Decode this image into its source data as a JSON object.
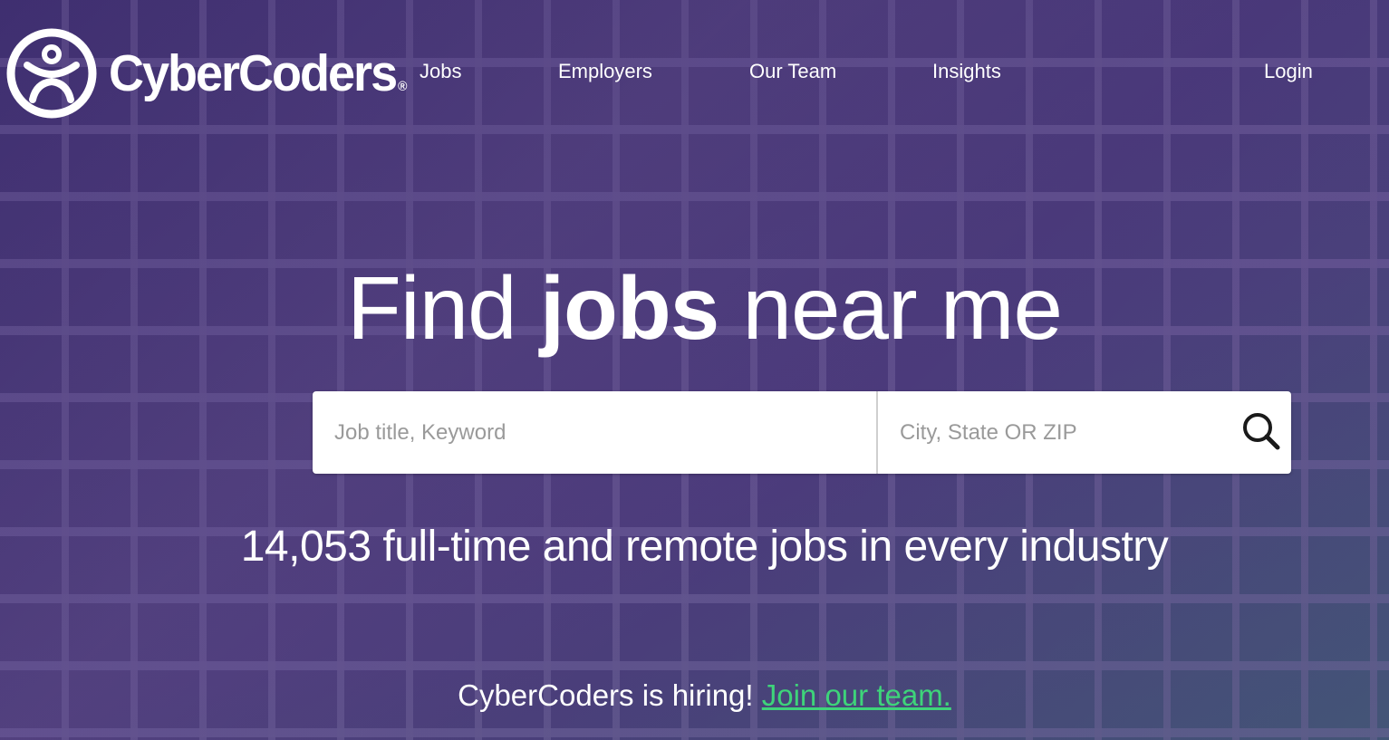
{
  "brand": {
    "name": "CyberCoders",
    "registered_mark": "®",
    "logo_icon": "person-circle-icon"
  },
  "nav": {
    "jobs": "Jobs",
    "employers": "Employers",
    "our_team": "Our Team",
    "insights": "Insights",
    "login": "Login"
  },
  "hero": {
    "headline_prefix": "Find ",
    "headline_bold": "jobs",
    "headline_suffix": " near me",
    "subheadline": "14,053 full-time and remote jobs in every industry",
    "hiring_text": "CyberCoders is hiring! ",
    "hiring_link": "Join our team."
  },
  "search": {
    "keyword_placeholder": "Job title, Keyword",
    "keyword_value": "",
    "location_placeholder": "City, State OR ZIP",
    "location_value": "",
    "button_icon": "search-icon"
  },
  "colors": {
    "background": "#4b3a7c",
    "link_accent": "#3ed47a",
    "text": "#ffffff",
    "placeholder": "#9a9a9a"
  }
}
